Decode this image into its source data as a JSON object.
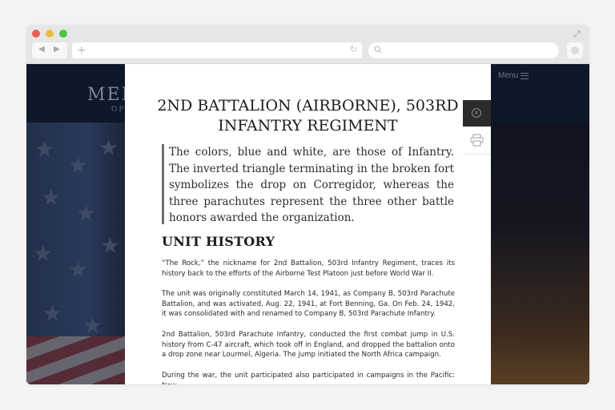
{
  "browser": {
    "window_controls": [
      "close",
      "minimize",
      "maximize"
    ],
    "back_icon": "back-arrow-icon",
    "forward_icon": "forward-arrow-icon",
    "new_tab_icon": "plus-icon",
    "reload_icon": "reload-icon",
    "search_icon": "search-icon",
    "new_tab_symbol": "+",
    "reload_symbol": "↻",
    "back_symbol": "◀",
    "forward_symbol": "▶",
    "expand_symbol": "⤢"
  },
  "background_page": {
    "logo_text": "MEI",
    "logo_subtext": "OP",
    "menu_label": "Menu"
  },
  "modal": {
    "title": "2ND BATTALION (AIRBORNE), 503RD INFANTRY REGIMENT",
    "quote": "The colors, blue and white, are those of Infantry. The inverted triangle terminating in the broken fort symbolizes the drop on Corregidor, whereas the three parachutes represent the three other battle honors awarded the organization.",
    "section_title": "UNIT HISTORY",
    "paragraphs": [
      "“The Rock,” the nickname for 2nd Battalion, 503rd Infantry Regiment, traces its history back to the efforts of the Airborne Test Platoon just before World War II.",
      "The unit was originally constituted March 14, 1941, as Company B, 503rd Parachute Battalion, and was activated, Aug. 22, 1941, at Fort Benning, Ga. On Feb. 24, 1942, it was consolidated with and renamed to Company B, 503rd Parachute Infantry.",
      "2nd Battalion, 503rd Parachute Infantry, conducted the first combat jump in U.S. history from C-47 aircraft, which took off in England, and dropped the battalion onto a drop zone near Lourmel, Algeria. The jump initiated the North Africa campaign.",
      "During the war, the unit participated also participated in campaigns in the Pacific: New"
    ],
    "close_icon": "close-circle-icon",
    "close_symbol": "×",
    "print_icon": "printer-icon"
  }
}
